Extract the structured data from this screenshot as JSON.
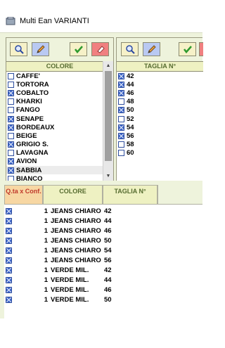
{
  "window": {
    "title": "Multi Ean VARIANTI"
  },
  "colors": {
    "checkbox_on": "#3a63c8",
    "panel_bg": "#eef3dc",
    "header_text": "#556b2f",
    "qty_header_bg": "#f7d7a3",
    "qty_header_text": "#c0392b"
  },
  "left_panel": {
    "header": "COLORE",
    "items": [
      {
        "label": "CAFFE'",
        "checked": false
      },
      {
        "label": "TORTORA",
        "checked": false
      },
      {
        "label": "COBALTO",
        "checked": true
      },
      {
        "label": "KHARKI",
        "checked": false
      },
      {
        "label": "FANGO",
        "checked": false
      },
      {
        "label": "SENAPE",
        "checked": true
      },
      {
        "label": "BORDEAUX",
        "checked": true
      },
      {
        "label": "BEIGE",
        "checked": false
      },
      {
        "label": "GRIGIO S.",
        "checked": true
      },
      {
        "label": "LAVAGNA",
        "checked": false
      },
      {
        "label": "AVION",
        "checked": true
      },
      {
        "label": "SABBIA",
        "checked": true
      },
      {
        "label": "BIANCO",
        "checked": false
      }
    ]
  },
  "right_panel": {
    "header": "TAGLIA N°",
    "items": [
      {
        "label": "42",
        "checked": true
      },
      {
        "label": "44",
        "checked": true
      },
      {
        "label": "46",
        "checked": true
      },
      {
        "label": "48",
        "checked": false
      },
      {
        "label": "50",
        "checked": true
      },
      {
        "label": "52",
        "checked": false
      },
      {
        "label": "54",
        "checked": true
      },
      {
        "label": "56",
        "checked": true
      },
      {
        "label": "58",
        "checked": false
      },
      {
        "label": "60",
        "checked": false
      }
    ]
  },
  "grid": {
    "headers": {
      "qty": "Q.ta x Conf.",
      "color": "COLORE",
      "size": "TAGLIA N°"
    },
    "rows": [
      {
        "qty": "1",
        "color": "JEANS CHIARO",
        "size": "42"
      },
      {
        "qty": "1",
        "color": "JEANS CHIARO",
        "size": "44"
      },
      {
        "qty": "1",
        "color": "JEANS CHIARO",
        "size": "46"
      },
      {
        "qty": "1",
        "color": "JEANS CHIARO",
        "size": "50"
      },
      {
        "qty": "1",
        "color": "JEANS CHIARO",
        "size": "54"
      },
      {
        "qty": "1",
        "color": "JEANS CHIARO",
        "size": "56"
      },
      {
        "qty": "1",
        "color": "VERDE MIL.",
        "size": "42"
      },
      {
        "qty": "1",
        "color": "VERDE MIL.",
        "size": "44"
      },
      {
        "qty": "1",
        "color": "VERDE MIL.",
        "size": "46"
      },
      {
        "qty": "1",
        "color": "VERDE MIL.",
        "size": "50"
      }
    ]
  }
}
